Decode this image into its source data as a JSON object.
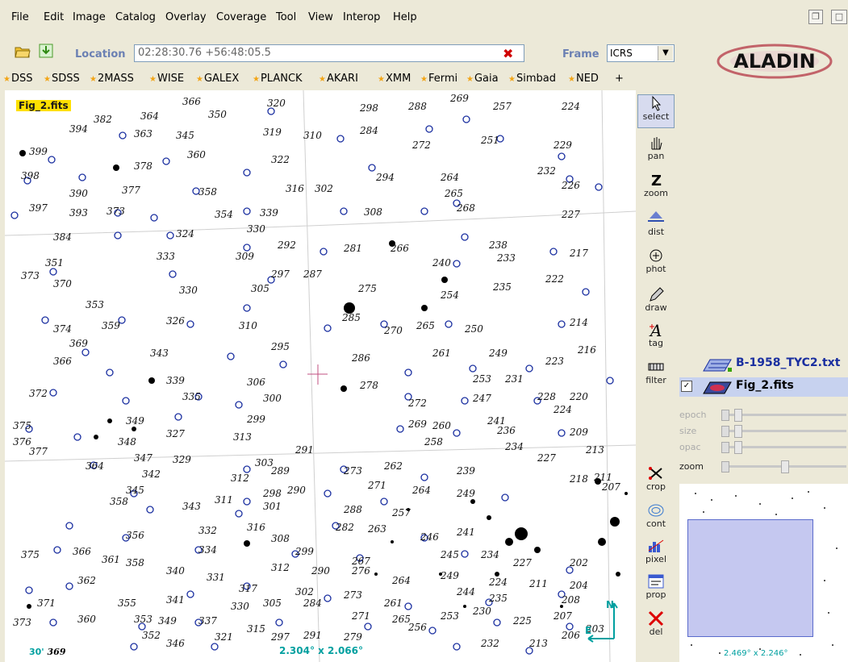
{
  "menu": {
    "items": [
      "File",
      "Edit",
      "Image",
      "Catalog",
      "Overlay",
      "Coverage",
      "Tool",
      "View",
      "Interop",
      "Help"
    ]
  },
  "location": {
    "label": "Location",
    "value": "02:28:30.76 +56:48:05.5",
    "frame_label": "Frame",
    "frame_value": "ICRS"
  },
  "logo": {
    "text": "ALADIN"
  },
  "surveys": [
    "DSS",
    "SDSS",
    "2MASS",
    "WISE",
    "GALEX",
    "PLANCK",
    "AKARI",
    "XMM",
    "Fermi",
    "Gaia",
    "Simbad",
    "NED",
    "+"
  ],
  "view": {
    "title": "Fig_2.fits",
    "scale": "30'",
    "scale_num": "369",
    "coord_readout": "2.304° x 2.066°",
    "compass_n": "N",
    "compass_e": "E"
  },
  "tools": [
    {
      "label": "select",
      "icon": "cursor-icon"
    },
    {
      "label": "pan",
      "icon": "hand-icon"
    },
    {
      "label": "zoom",
      "icon": "zoom-icon"
    },
    {
      "label": "dist",
      "icon": "dist-icon"
    },
    {
      "label": "phot",
      "icon": "phot-icon"
    },
    {
      "label": "draw",
      "icon": "pencil-icon"
    },
    {
      "label": "tag",
      "icon": "tag-icon"
    },
    {
      "label": "filter",
      "icon": "filter-icon"
    },
    {
      "label": "crop",
      "icon": "scissors-icon"
    },
    {
      "label": "cont",
      "icon": "contour-icon"
    },
    {
      "label": "pixel",
      "icon": "pixel-icon"
    },
    {
      "label": "prop",
      "icon": "prop-icon"
    },
    {
      "label": "del",
      "icon": "delete-icon"
    }
  ],
  "planes": [
    {
      "name": "B-1958_TYC2.txt",
      "color": "#1a2fa0"
    },
    {
      "name": "Fig_2.fits",
      "color": "#000000"
    }
  ],
  "sliders": {
    "epoch": "epoch",
    "size": "size",
    "opac": "opac",
    "zoom": "zoom"
  },
  "thumbnail": {
    "size": "2.469° x 2.246°"
  },
  "colors": {
    "accent": "#6b80b3",
    "overlay": "#1a2fa0",
    "readout": "#00a0a0"
  }
}
